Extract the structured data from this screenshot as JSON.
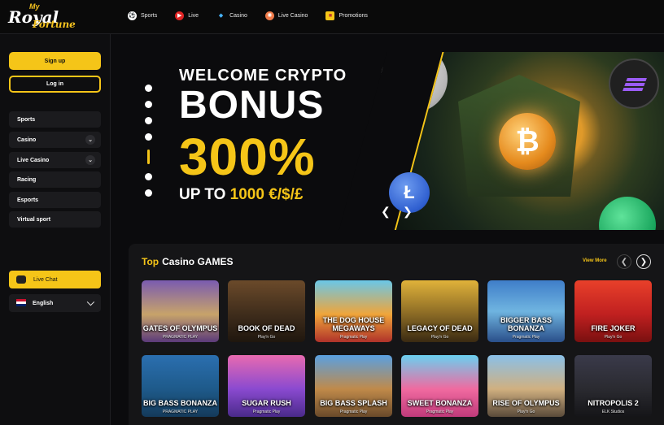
{
  "brand": {
    "line1": "My",
    "line2": "Royal",
    "line3": "Fortune"
  },
  "nav": [
    {
      "label": "Sports",
      "icon": "soccer-ball-icon",
      "color": "#ffffff"
    },
    {
      "label": "Live",
      "icon": "live-play-icon",
      "color": "#e02424"
    },
    {
      "label": "Casino",
      "icon": "diamond-icon",
      "color": "#47b4ff"
    },
    {
      "label": "Live Casino",
      "icon": "roulette-icon",
      "color": "#f07b4a"
    },
    {
      "label": "Promotions",
      "icon": "gift-icon",
      "color": "#f5c518"
    }
  ],
  "sidebar": {
    "signup": "Sign up",
    "login": "Log in",
    "menu": [
      {
        "label": "Sports",
        "expandable": false
      },
      {
        "label": "Casino",
        "expandable": true
      },
      {
        "label": "Live Casino",
        "expandable": true
      },
      {
        "label": "Racing",
        "expandable": false
      },
      {
        "label": "Esports",
        "expandable": false
      },
      {
        "label": "Virtual sport",
        "expandable": false
      }
    ],
    "live_chat": "Live Chat",
    "language": "English"
  },
  "banner": {
    "line1": "WELCOME CRYPTO",
    "line2": "BONUS",
    "line3": "300%",
    "line4_prefix": "UP TO ",
    "line4_amount": "1000 €/$/£"
  },
  "games_section": {
    "title_accent": "Top",
    "title": "Casino GAMES",
    "view_more": "View More",
    "games": [
      {
        "name": "GATES OF OLYMPUS",
        "provider": "PRAGMATIC PLAY",
        "bg": "linear-gradient(#7a5bb0, #c7a36a 55%, #5b3a7a)"
      },
      {
        "name": "BOOK OF DEAD",
        "provider": "Play'n Go",
        "bg": "linear-gradient(#6b4a2a, #3b2a1a 60%, #1f160e)"
      },
      {
        "name": "THE DOG HOUSE MEGAWAYS",
        "provider": "Pragmatic Play",
        "bg": "linear-gradient(#6ac7e8, #f0a53a 55%, #b0322a)"
      },
      {
        "name": "LEGACY OF DEAD",
        "provider": "Play'n Go",
        "bg": "linear-gradient(#e0b23a, #8a6a25 55%, #3a2a12)"
      },
      {
        "name": "BIGGER BASS BONANZA",
        "provider": "Pragmatic Play",
        "bg": "linear-gradient(#3f7ec9, #6fb4e0 50%, #2a4f8a)"
      },
      {
        "name": "FIRE JOKER",
        "provider": "Play'n Go",
        "bg": "linear-gradient(#e8402a, #c02020 55%, #7a1010)"
      },
      {
        "name": "BIG BASS BONANZA",
        "provider": "PRAGMATIC PLAY",
        "bg": "linear-gradient(#2b6fb0, #1e5a8a 55%, #143a5a)"
      },
      {
        "name": "SUGAR RUSH",
        "provider": "Pragmatic Play",
        "bg": "linear-gradient(#e86ab0, #8a4ad0 55%, #4a2a8a)"
      },
      {
        "name": "BIG BASS SPLASH",
        "provider": "Pragmatic Play",
        "bg": "linear-gradient(#5aa0e0, #c08a4a 55%, #6a4a2a)"
      },
      {
        "name": "SWEET BONANZA",
        "provider": "Pragmatic Play",
        "bg": "linear-gradient(#6ad0f0, #f06aa0 55%, #c03a7a)"
      },
      {
        "name": "RISE OF OLYMPUS",
        "provider": "Play'n Go",
        "bg": "linear-gradient(#8ac0e8, #d0b080 55%, #5a4a3a)"
      },
      {
        "name": "NITROPOLIS 2",
        "provider": "ELK Studios",
        "bg": "linear-gradient(#3a3a4a, #2a2a30 55%, #151518)"
      }
    ]
  }
}
